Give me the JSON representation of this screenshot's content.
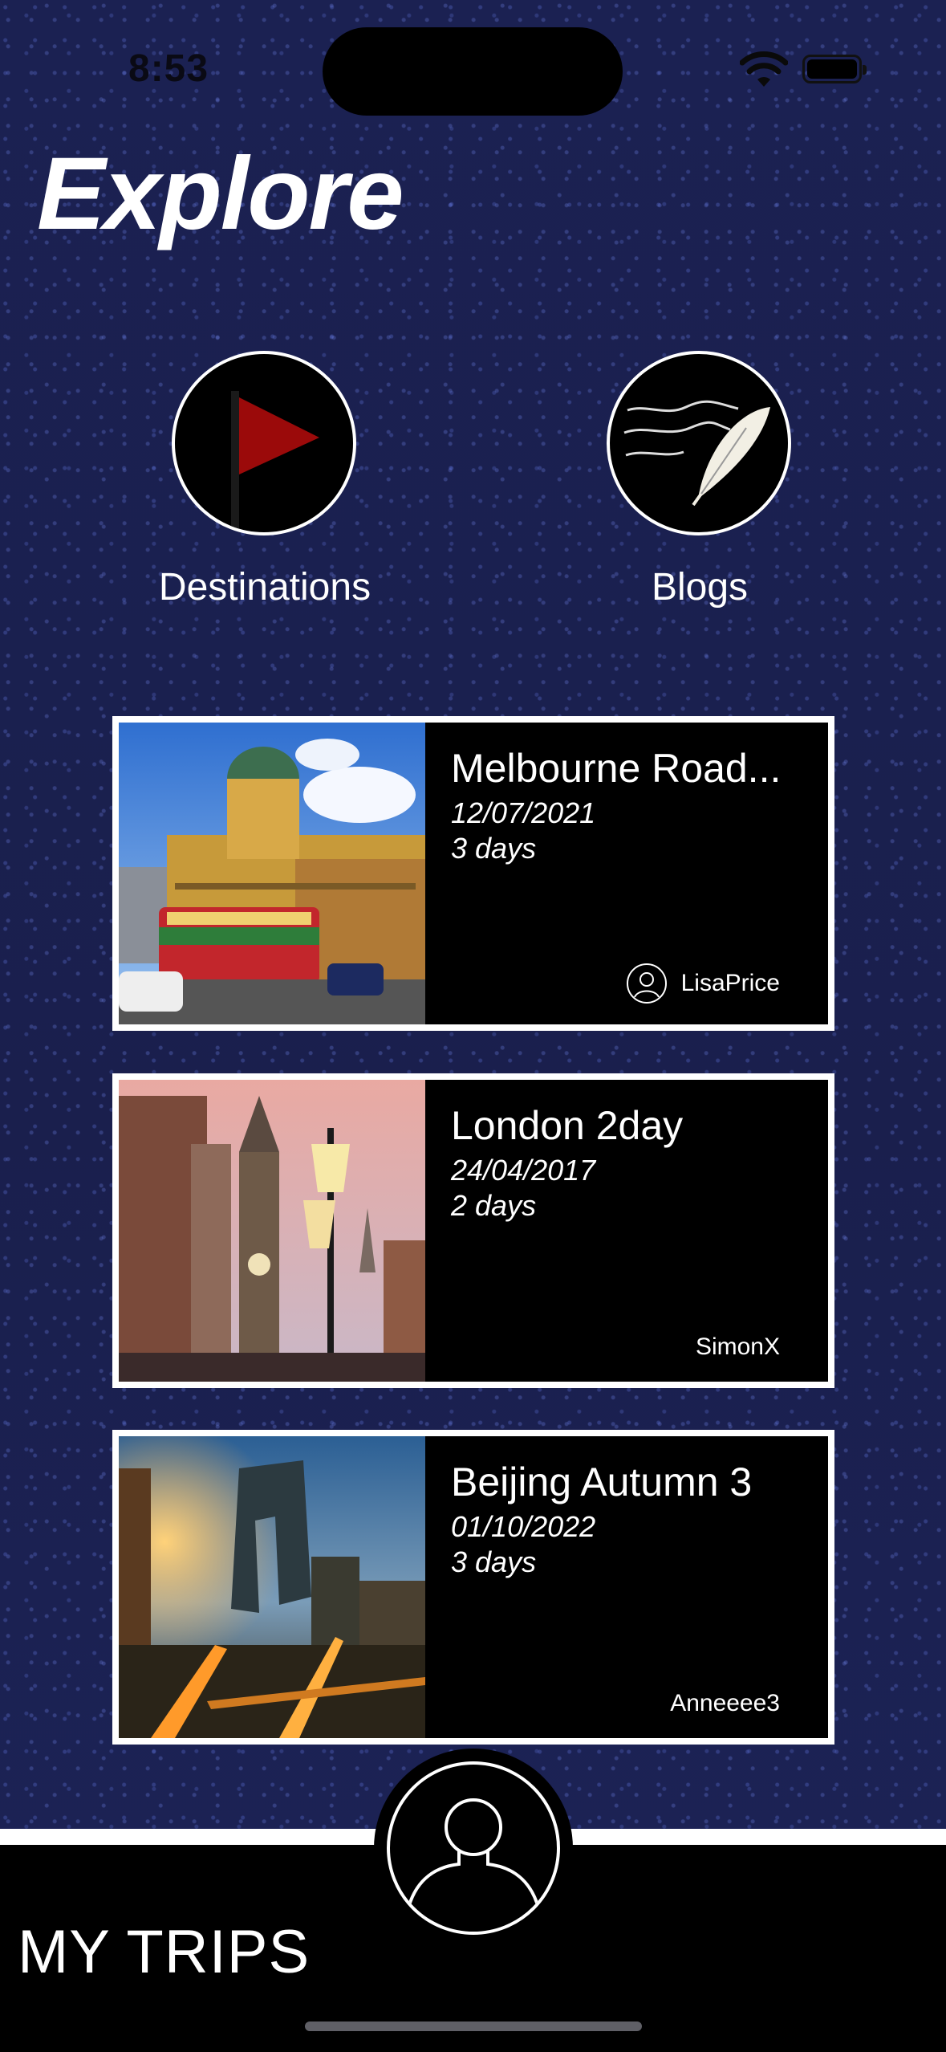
{
  "status_bar": {
    "time": "8:53"
  },
  "page": {
    "title": "Explore"
  },
  "nav": [
    {
      "label": "Destinations",
      "icon": "flag-icon"
    },
    {
      "label": "Blogs",
      "icon": "quill-icon"
    }
  ],
  "trips": [
    {
      "title": "Melbourne Road...",
      "date": "12/07/2021",
      "duration": "3 days",
      "author": "LisaPrice",
      "has_avatar": true
    },
    {
      "title": "London 2day",
      "date": "24/04/2017",
      "duration": "2 days",
      "author": "SimonX",
      "has_avatar": false
    },
    {
      "title": "Beijing Autumn 3",
      "date": "01/10/2022",
      "duration": "3 days",
      "author": "Anneeee3",
      "has_avatar": false
    }
  ],
  "tab_bar": {
    "label": "MY TRIPS",
    "profile_icon": "user-profile-icon"
  },
  "colors": {
    "background": "#1a2152",
    "card_bg": "#000000",
    "card_border": "#ffffff",
    "flag": "#9b0a0a",
    "text": "#ffffff"
  }
}
